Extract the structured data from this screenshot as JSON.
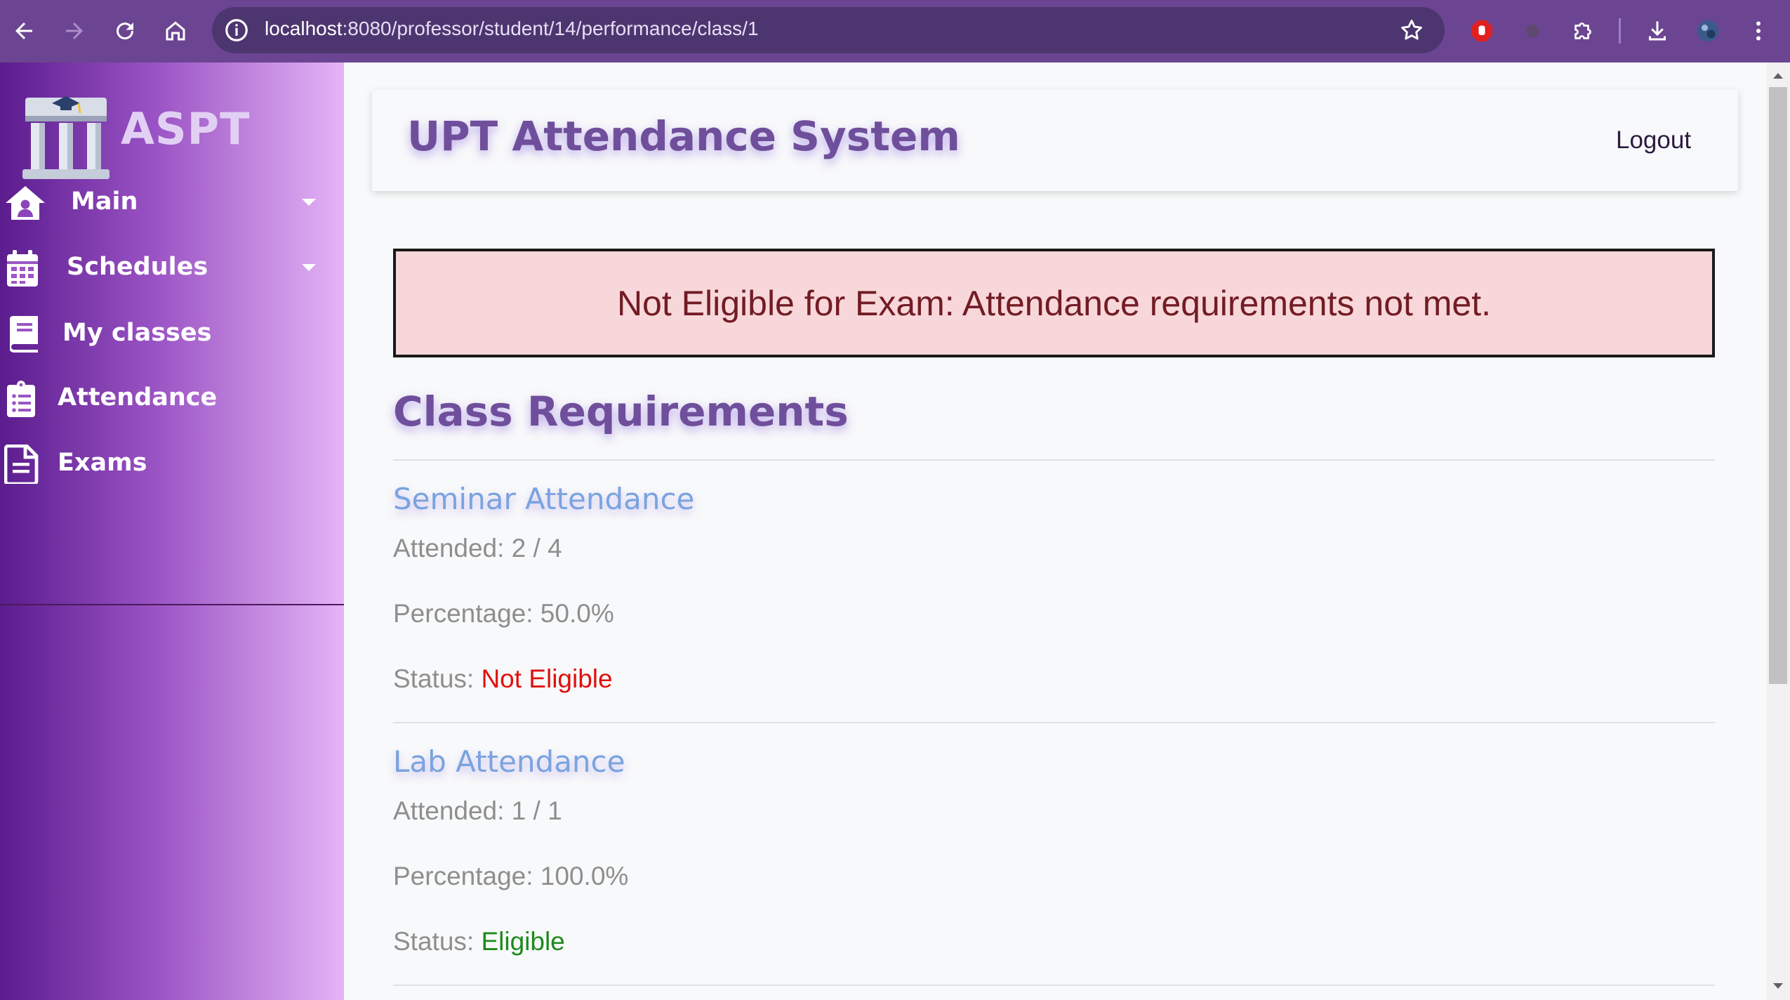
{
  "browser": {
    "url_host": "localhost",
    "url_path": ":8080/professor/student/14/performance/class/1"
  },
  "sidebar": {
    "brand": "ASPT",
    "items": [
      {
        "label": "Main",
        "icon": "house-user-icon",
        "has_dropdown": true
      },
      {
        "label": "Schedules",
        "icon": "calendar-icon",
        "has_dropdown": true
      },
      {
        "label": "My classes",
        "icon": "book-icon",
        "has_dropdown": false
      },
      {
        "label": "Attendance",
        "icon": "clipboard-list-icon",
        "has_dropdown": false
      },
      {
        "label": "Exams",
        "icon": "file-lines-icon",
        "has_dropdown": false
      }
    ]
  },
  "header": {
    "title": "UPT Attendance System",
    "logout_label": "Logout"
  },
  "alert": {
    "message": "Not Eligible for Exam: Attendance requirements not met."
  },
  "requirements": {
    "title": "Class Requirements",
    "items": [
      {
        "name": "Seminar Attendance",
        "attended": "Attended: 2 / 4",
        "percentage": "Percentage: 50.0%",
        "status_label": "Status: ",
        "status": "Not Eligible"
      },
      {
        "name": "Lab Attendance",
        "attended": "Attended: 1 / 1",
        "percentage": "Percentage: 100.0%",
        "status_label": "Status: ",
        "status": "Eligible"
      }
    ]
  },
  "colors": {
    "accent_purple": "#6f4f9b",
    "link_blue": "#7aa3e0",
    "not_eligible": "#e01010",
    "eligible": "#1c8a1c",
    "alert_bg": "#f8d7da"
  }
}
